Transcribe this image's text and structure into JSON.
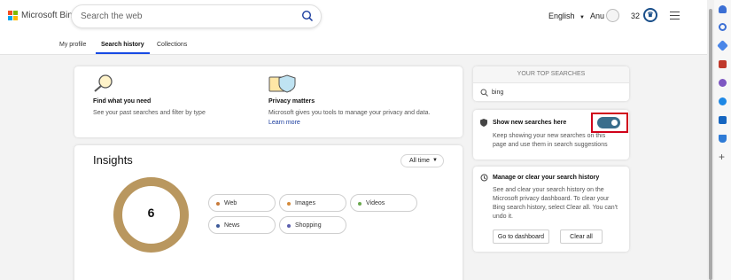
{
  "header": {
    "brand": "Microsoft Bing",
    "search_placeholder": "Search the web",
    "language": "English",
    "user_name": "Anu",
    "points": "32"
  },
  "tabs": [
    {
      "label": "My profile",
      "active": false
    },
    {
      "label": "Search history",
      "active": true
    },
    {
      "label": "Collections",
      "active": false
    }
  ],
  "info_cards": [
    {
      "title": "Find what you need",
      "text": "See your past searches and filter by type",
      "icon": "magnifier-illustration"
    },
    {
      "title": "Privacy matters",
      "text": "Microsoft gives you tools to manage your privacy and data.",
      "link": "Learn more",
      "icon": "shield-illustration"
    }
  ],
  "insights": {
    "title": "Insights",
    "filter": "All time",
    "total": "6",
    "donut_color": "#b9975f",
    "categories": [
      {
        "label": "Web",
        "color": "#c87b3a"
      },
      {
        "label": "Images",
        "color": "#d48a3a"
      },
      {
        "label": "Videos",
        "color": "#6aa84f"
      },
      {
        "label": "News",
        "color": "#3d5a99"
      },
      {
        "label": "Shopping",
        "color": "#5b5fae"
      }
    ]
  },
  "top_searches": {
    "title": "YOUR TOP SEARCHES",
    "items": [
      "bing"
    ]
  },
  "show_searches": {
    "title": "Show new searches here",
    "desc_lines": [
      "Keep showing your new searches on this",
      "page and use them in search suggestions"
    ],
    "toggle_on": true,
    "accent_color": "#3a6e8c",
    "highlight_color": "#d0021b"
  },
  "manage": {
    "title": "Manage or clear your search history",
    "desc_lines": [
      "See and clear your search history on the",
      "Microsoft privacy dashboard. To clear your",
      "Bing search history, select Clear all. You can't",
      "undo it."
    ],
    "dashboard_button": "Go to dashboard",
    "clear_button": "Clear all"
  },
  "sidebar_icons": [
    "bell-icon",
    "search-icon",
    "tag-icon",
    "toolbox-icon",
    "people-icon",
    "office-icon",
    "outlook-icon",
    "shopping-cart-icon",
    "add-icon"
  ]
}
